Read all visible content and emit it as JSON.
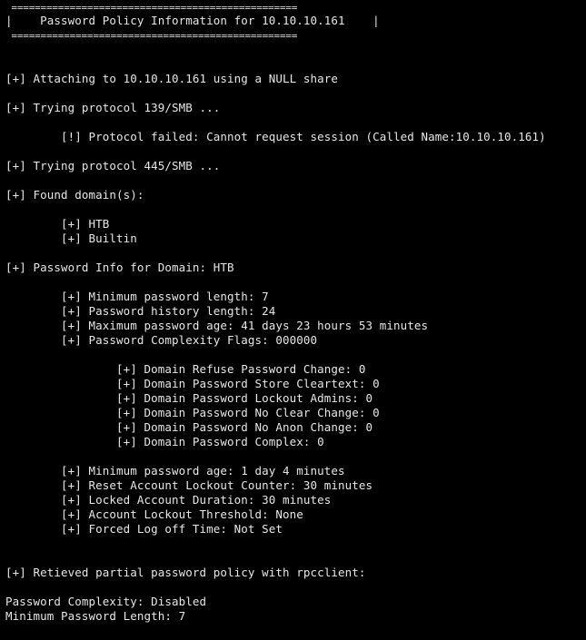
{
  "banner": {
    "top_rule": " =================================================",
    "title_line": "|    Password Policy Information for 10.10.10.161    |",
    "bottom_rule": " ================================================="
  },
  "lines": {
    "attach": "[+] Attaching to 10.10.10.161 using a NULL share",
    "try139": "[+] Trying protocol 139/SMB ...",
    "fail139": "        [!] Protocol failed: Cannot request session (Called Name:10.10.10.161)",
    "try445": "[+] Trying protocol 445/SMB ...",
    "found_domains": "[+] Found domain(s):",
    "domain_htb": "        [+] HTB",
    "domain_builtin": "        [+] Builtin",
    "pw_info": "[+] Password Info for Domain: HTB",
    "min_len": "        [+] Minimum password length: 7",
    "history": "        [+] Password history length: 24",
    "max_age": "        [+] Maximum password age: 41 days 23 hours 53 minutes",
    "complexity_flags": "        [+] Password Complexity Flags: 000000",
    "refuse_change": "                [+] Domain Refuse Password Change: 0",
    "store_cleartext": "                [+] Domain Password Store Cleartext: 0",
    "lockout_admins": "                [+] Domain Password Lockout Admins: 0",
    "no_clear_change": "                [+] Domain Password No Clear Change: 0",
    "no_anon_change": "                [+] Domain Password No Anon Change: 0",
    "pw_complex": "                [+] Domain Password Complex: 0",
    "min_age": "        [+] Minimum password age: 1 day 4 minutes",
    "reset_counter": "        [+] Reset Account Lockout Counter: 30 minutes",
    "lock_duration": "        [+] Locked Account Duration: 30 minutes",
    "lock_threshold": "        [+] Account Lockout Threshold: None",
    "forced_logoff": "        [+] Forced Log off Time: Not Set",
    "rpc_retrieved": "[+] Retieved partial password policy with rpcclient:",
    "rpc_complexity": "Password Complexity: Disabled",
    "rpc_min_len": "Minimum Password Length: 7"
  },
  "colors": {
    "background": "#000000",
    "foreground": "#e6e6e6"
  }
}
